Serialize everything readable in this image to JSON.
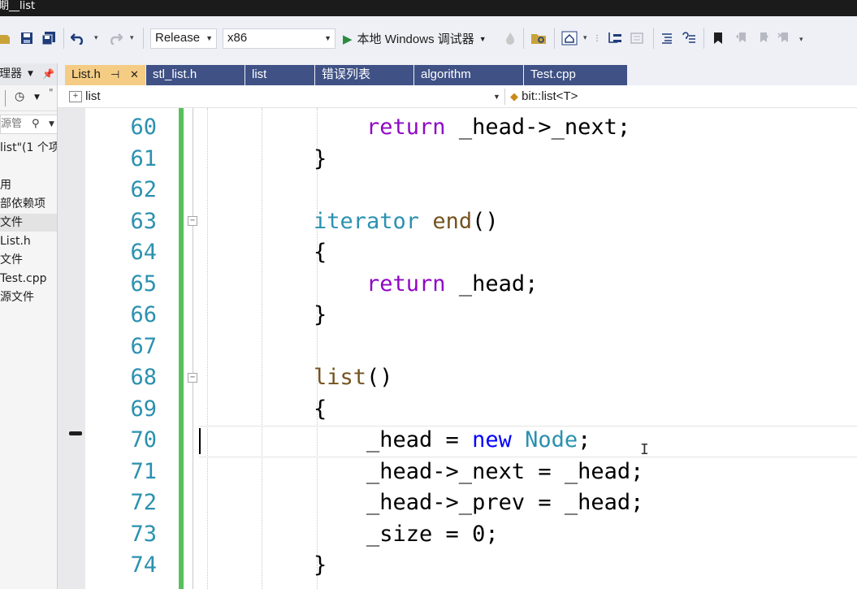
{
  "window": {
    "title_fragment": "期__list"
  },
  "toolbar": {
    "configuration": "Release",
    "platform": "x86",
    "run_label": "本地 Windows 调试器"
  },
  "solution_explorer": {
    "header": "理器",
    "search_placeholder": "源管",
    "items": [
      {
        "label": "list\"(1 个项"
      },
      {
        "label": "用"
      },
      {
        "label": "部依赖项"
      },
      {
        "label": "文件"
      },
      {
        "label": "List.h"
      },
      {
        "label": "文件"
      },
      {
        "label": "Test.cpp"
      },
      {
        "label": "源文件"
      }
    ]
  },
  "tabs": [
    {
      "label": "List.h",
      "active": true
    },
    {
      "label": "stl_list.h"
    },
    {
      "label": "list"
    },
    {
      "label": "错误列表"
    },
    {
      "label": "algorithm"
    },
    {
      "label": "Test.cpp"
    }
  ],
  "navbar": {
    "scope": "list",
    "member": "bit::list<T>"
  },
  "editor": {
    "line_numbers": [
      "60",
      "61",
      "62",
      "63",
      "64",
      "65",
      "66",
      "67",
      "68",
      "69",
      "70",
      "71",
      "72",
      "73",
      "74"
    ],
    "current_line": "70"
  },
  "colors": {
    "tab_active": "#f5cc84",
    "tab_inactive": "#3f5185",
    "keyword": "#8f08c4",
    "keyword_new": "#0000ff",
    "type": "#2b91af",
    "function": "#74531f",
    "line_number": "#2b91af",
    "change_bar": "#57c05a"
  },
  "icons": [
    "save-icon",
    "save-all-icon",
    "undo-icon",
    "redo-icon",
    "play-icon",
    "folder-icon",
    "home-icon",
    "bookmark-icon",
    "pin-icon",
    "close-icon",
    "search-icon"
  ]
}
